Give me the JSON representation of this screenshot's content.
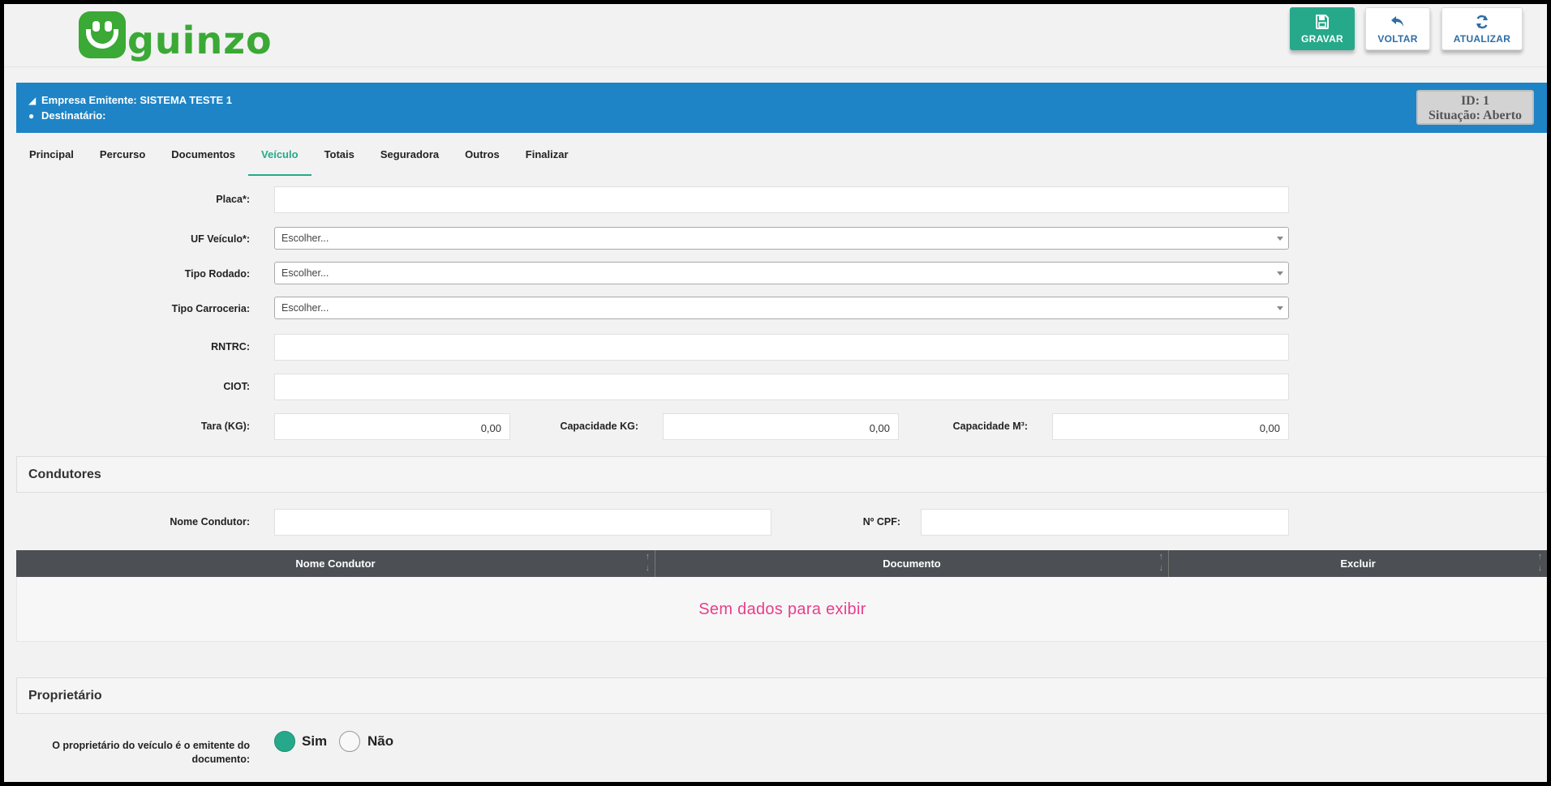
{
  "header": {
    "logo_text": "guinzo",
    "buttons": {
      "save": {
        "label": "GRAVAR",
        "icon": "floppy-disk-icon"
      },
      "back": {
        "label": "VOLTAR",
        "icon": "undo-arrow-icon"
      },
      "refresh": {
        "label": "ATUALIZAR",
        "icon": "refresh-icon"
      }
    }
  },
  "info": {
    "emitter": "Empresa Emitente: SISTEMA TESTE 1",
    "recipient": "Destinatário:",
    "id_text": "ID: 1",
    "status_text": "Situação: Aberto",
    "bar_color": "#1e84c6"
  },
  "tabs": [
    {
      "label": "Principal"
    },
    {
      "label": "Percurso"
    },
    {
      "label": "Documentos"
    },
    {
      "label": "Veículo",
      "active": true
    },
    {
      "label": "Totais"
    },
    {
      "label": "Seguradora"
    },
    {
      "label": "Outros"
    },
    {
      "label": "Finalizar"
    }
  ],
  "vehicle": {
    "plate_label": "Placa*:",
    "plate_value": "",
    "uf_label": "UF Veículo*:",
    "uf_value": "Escolher...",
    "wheel_type_label": "Tipo Rodado:",
    "wheel_type_value": "Escolher...",
    "body_type_label": "Tipo Carroceria:",
    "body_type_value": "Escolher...",
    "rntrc_label": "RNTRC:",
    "rntrc_value": "",
    "ciot_label": "CIOT:",
    "ciot_value": "",
    "tare_label": "Tara (KG):",
    "tare_value": "0,00",
    "capacity_kg_label": "Capacidade KG:",
    "capacity_kg_value": "0,00",
    "capacity_m3_label": "Capacidade M³:",
    "capacity_m3_value": "0,00"
  },
  "drivers": {
    "section_title": "Condutores",
    "name_label": "Nome Condutor:",
    "name_value": "",
    "cpf_label": "Nº CPF:",
    "cpf_value": "",
    "columns": [
      "Nome Condutor",
      "Documento",
      "Excluir"
    ],
    "empty_message": "Sem dados para exibir"
  },
  "owner": {
    "section_title": "Proprietário",
    "question_line1": "O proprietário do veículo é o emitente do",
    "question_line2": "documento:",
    "options": [
      "Sim",
      "Não"
    ],
    "selected": "Sim"
  },
  "colors": {
    "accent": "#26a98a",
    "empty_text": "#e83e8c",
    "brand_green": "#3aa935"
  }
}
